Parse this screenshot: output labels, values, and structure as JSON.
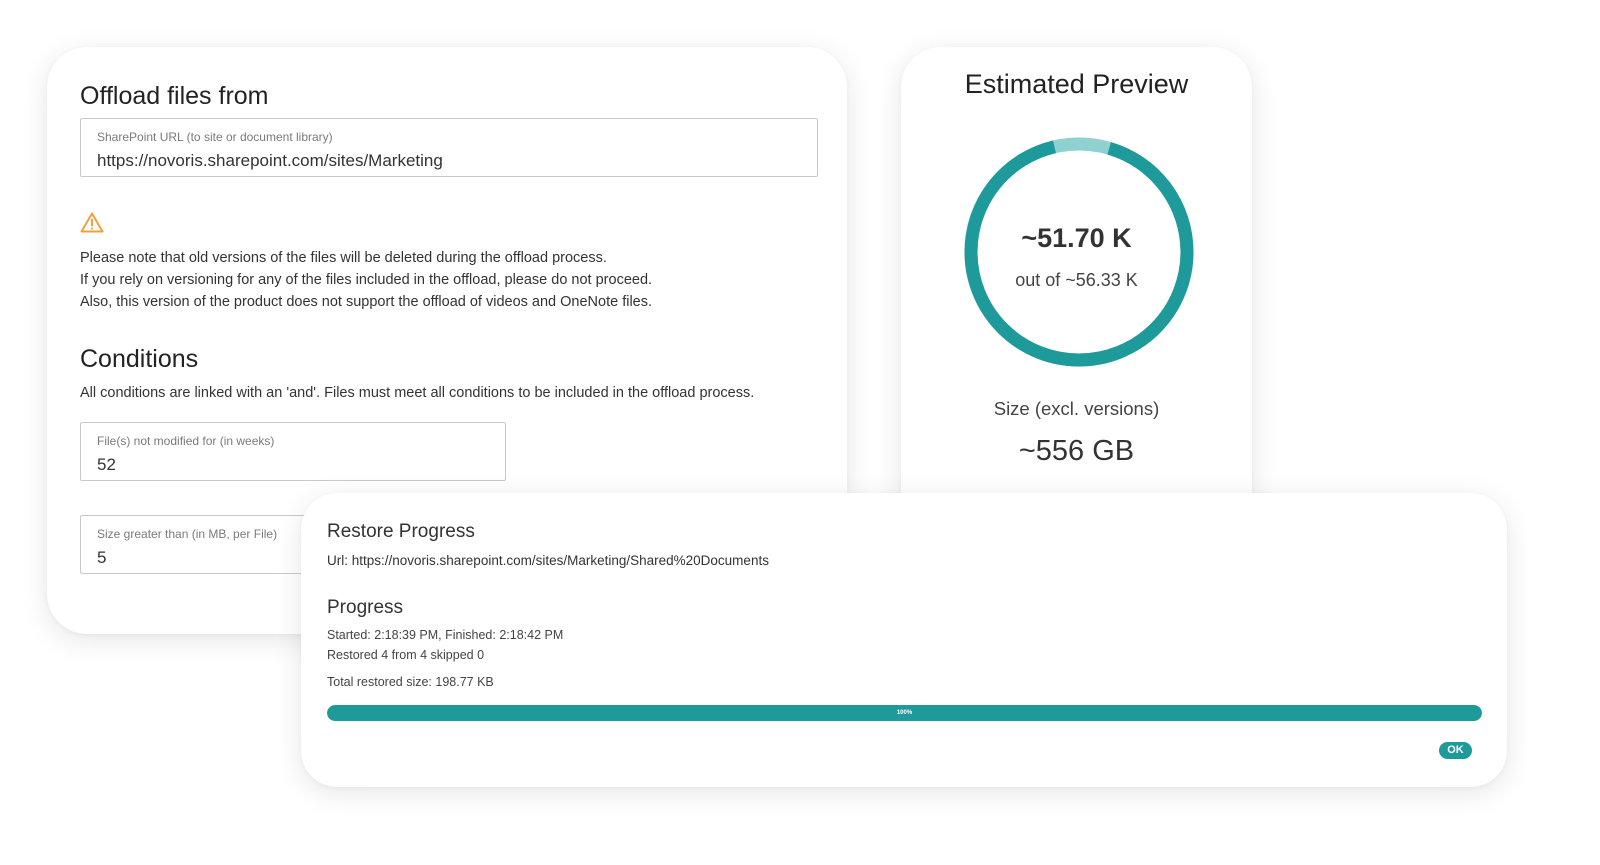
{
  "offload": {
    "title": "Offload files from",
    "url_field": {
      "label": "SharePoint URL (to site or document library)",
      "value": "https://novoris.sharepoint.com/sites/Marketing"
    },
    "warning_icon": "warning-triangle-icon",
    "warning_lines": [
      "Please note that old versions of the files will be deleted during the offload process.",
      "If you rely on versioning for any of the files included in the offload, please do not proceed.",
      "Also, this version of the product does not support the offload of videos and OneNote files."
    ],
    "conditions_title": "Conditions",
    "conditions_desc": "All conditions are linked with an 'and'. Files must meet all conditions to be included in the offload process.",
    "not_modified_field": {
      "label": "File(s) not modified for (in weeks)",
      "value": "52"
    },
    "size_field": {
      "label": "Size greater than (in MB, per File)",
      "value": "5"
    }
  },
  "preview": {
    "title": "Estimated Preview",
    "count_value": "~51.70 K",
    "count_total": "out of ~56.33 K",
    "fraction": 0.918,
    "size_label": "Size (excl. versions)",
    "size_value": "~556 GB"
  },
  "restore": {
    "title": "Restore Progress",
    "url_text": "Url: https://novoris.sharepoint.com/sites/Marketing/Shared%20Documents",
    "progress_title": "Progress",
    "times": "Started: 2:18:39 PM, Finished: 2:18:42 PM",
    "restored": "Restored 4 from 4 skipped 0",
    "total_size": "Total restored size: 198.77 KB",
    "percent": 100,
    "percent_label": "100%",
    "ok_label": "OK"
  },
  "colors": {
    "accent": "#1f9a9b",
    "accent_light": "#8fd0d0",
    "warning": "#f2a03d"
  }
}
